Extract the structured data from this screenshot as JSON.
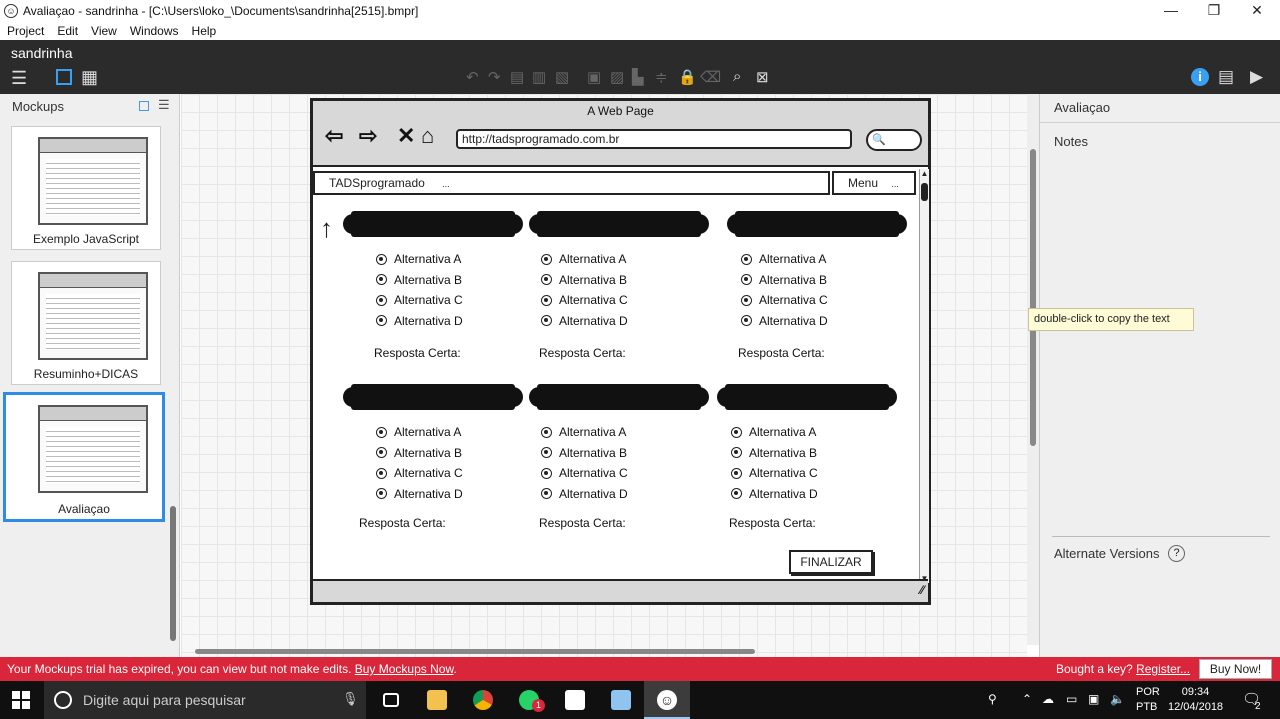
{
  "window": {
    "title": "Avaliaçao - sandrinha - [C:\\Users\\loko_\\Documents\\sandrinha[2515].bmpr]",
    "controls": {
      "minimize": "—",
      "maximize": "❐",
      "close": "✕"
    }
  },
  "menu": [
    "Project",
    "Edit",
    "View",
    "Windows",
    "Help"
  ],
  "app": {
    "project_name": "sandrinha"
  },
  "left_panel": {
    "title": "Mockups",
    "thumbnails": [
      {
        "label": "Exemplo JavaScript",
        "selected": false
      },
      {
        "label": "Resuminho+DICAS",
        "selected": false
      },
      {
        "label": "Avaliaçao",
        "selected": true
      }
    ]
  },
  "mockup": {
    "page_title": "A Web Page",
    "url": "http://tadsprogramado.com.br",
    "site_name": "TADSprogramado",
    "site_name_ellipsis": "...",
    "menu_label": "Menu",
    "menu_ellipsis": "...",
    "questions_row1": [
      {
        "options": [
          "Alternativa A",
          "Alternativa B",
          "Alternativa C",
          "Alternativa D"
        ],
        "answer_label": "Resposta Certa:"
      },
      {
        "options": [
          "Alternativa A",
          "Alternativa B",
          "Alternativa C",
          "Alternativa D"
        ],
        "answer_label": "Resposta Certa:"
      },
      {
        "options": [
          "Alternativa A",
          "Alternativa B",
          "Alternativa C",
          "Alternativa D"
        ],
        "answer_label": "Resposta Certa:"
      }
    ],
    "questions_row2": [
      {
        "options": [
          "Alternativa A",
          "Alternativa B",
          "Alternativa C",
          "Alternativa D"
        ],
        "answer_label": "Resposta Certa:"
      },
      {
        "options": [
          "Alternativa A",
          "Alternativa B",
          "Alternativa C",
          "Alternativa D"
        ],
        "answer_label": "Resposta Certa:"
      },
      {
        "options": [
          "Alternativa A",
          "Alternativa B",
          "Alternativa C",
          "Alternativa D"
        ],
        "answer_label": "Resposta Certa:"
      }
    ],
    "finish_button": "FINALIZAR"
  },
  "right_panel": {
    "title": "Avaliaçao",
    "notes_label": "Notes",
    "alternate_versions_label": "Alternate Versions",
    "help": "?"
  },
  "tooltip": "double-click to copy the text",
  "trial_bar": {
    "message": "Your Mockups trial has expired, you can view but not make edits.",
    "buy_link": "Buy Mockups Now",
    "period": ".",
    "bought_text": "Bought a key?",
    "register_link": "Register...",
    "buy_now_button": "Buy Now!",
    "color": "#d9263a"
  },
  "taskbar": {
    "search_placeholder": "Digite aqui para pesquisar",
    "lang_line1": "POR",
    "lang_line2": "PTB",
    "time": "09:34",
    "date": "12/04/2018",
    "notification_count": "2",
    "whatsapp_badge": "1"
  }
}
